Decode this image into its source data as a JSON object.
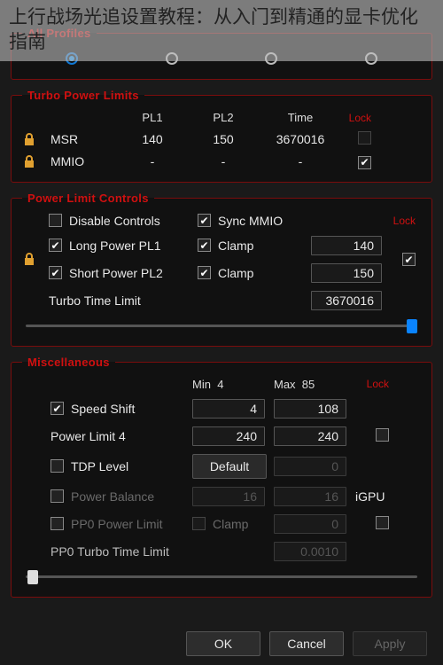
{
  "overlay_title": "上行战场光追设置教程：从入门到精通的显卡优化指南",
  "profiles": {
    "legend": "All Profiles"
  },
  "tpl": {
    "legend": "Turbo Power Limits",
    "headers": {
      "pl1": "PL1",
      "pl2": "PL2",
      "time": "Time",
      "lock": "Lock"
    },
    "rows": [
      {
        "name": "MSR",
        "pl1": "140",
        "pl2": "150",
        "time": "3670016"
      },
      {
        "name": "MMIO",
        "pl1": "-",
        "pl2": "-",
        "time": "-"
      }
    ]
  },
  "plc": {
    "legend": "Power Limit Controls",
    "lock": "Lock",
    "disable_controls": "Disable Controls",
    "sync_mmio": "Sync MMIO",
    "long_pl1": "Long Power PL1",
    "short_pl2": "Short Power PL2",
    "clamp": "Clamp",
    "turbo_time": "Turbo Time Limit",
    "pl1_val": "140",
    "pl2_val": "150",
    "time_val": "3670016"
  },
  "misc": {
    "legend": "Miscellaneous",
    "lock": "Lock",
    "min_label": "Min",
    "max_label": "Max",
    "min_header_val": "4",
    "max_header_val": "85",
    "speed_shift": {
      "label": "Speed Shift",
      "min": "4",
      "max": "108"
    },
    "pl4": {
      "label": "Power Limit 4",
      "min": "240",
      "max": "240"
    },
    "tdp": {
      "label": "TDP Level",
      "min": "Default",
      "max": "0"
    },
    "power_balance": {
      "label": "Power Balance",
      "min": "16",
      "max": "16",
      "side": "iGPU"
    },
    "pp0": {
      "label": "PP0 Power Limit",
      "clamp": "Clamp",
      "val": "0"
    },
    "pp0_time": {
      "label": "PP0 Turbo Time Limit",
      "val": "0.0010"
    }
  },
  "buttons": {
    "ok": "OK",
    "cancel": "Cancel",
    "apply": "Apply"
  }
}
